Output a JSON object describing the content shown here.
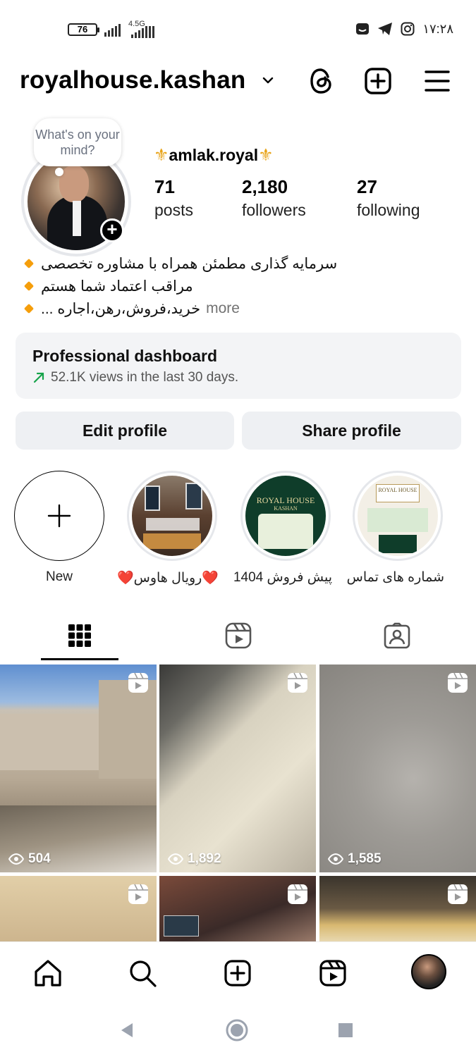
{
  "status_bar": {
    "battery": "76",
    "network": "4.5G",
    "time": "۱۷:۲۸"
  },
  "header": {
    "username": "royalhouse.kashan"
  },
  "profile": {
    "thought_bubble": "What's on your mind?",
    "display_name": "amlak.royal",
    "stats": {
      "posts_count": "71",
      "posts_label": "posts",
      "followers_count": "2,180",
      "followers_label": "followers",
      "following_count": "27",
      "following_label": "following"
    },
    "bio": [
      "سرمایه گذاری مطمئن همراه با مشاوره تخصصی",
      "مراقب اعتماد شما هستم",
      "خرید،فروش،رهن،اجاره ..."
    ],
    "bio_more": "more"
  },
  "dashboard": {
    "title": "Professional dashboard",
    "subtitle": "52.1K views in the last 30 days."
  },
  "buttons": {
    "edit": "Edit profile",
    "share": "Share profile"
  },
  "highlights": [
    {
      "label": "New"
    },
    {
      "label": "❤️رویال هاوس❤️"
    },
    {
      "label": "پیش فروش 1404"
    },
    {
      "label": "شماره های تماس"
    }
  ],
  "highlight_texts": {
    "royal_house": "ROYAL HOUSE",
    "kashan": "KASHAN"
  },
  "grid": [
    {
      "views": "504"
    },
    {
      "views": "1,892"
    },
    {
      "views": "1,585"
    },
    {
      "views": ""
    },
    {
      "views": ""
    },
    {
      "views": ""
    }
  ],
  "colors": {
    "accent_green": "#16a34a",
    "bullet_orange": "#f59e0b"
  }
}
